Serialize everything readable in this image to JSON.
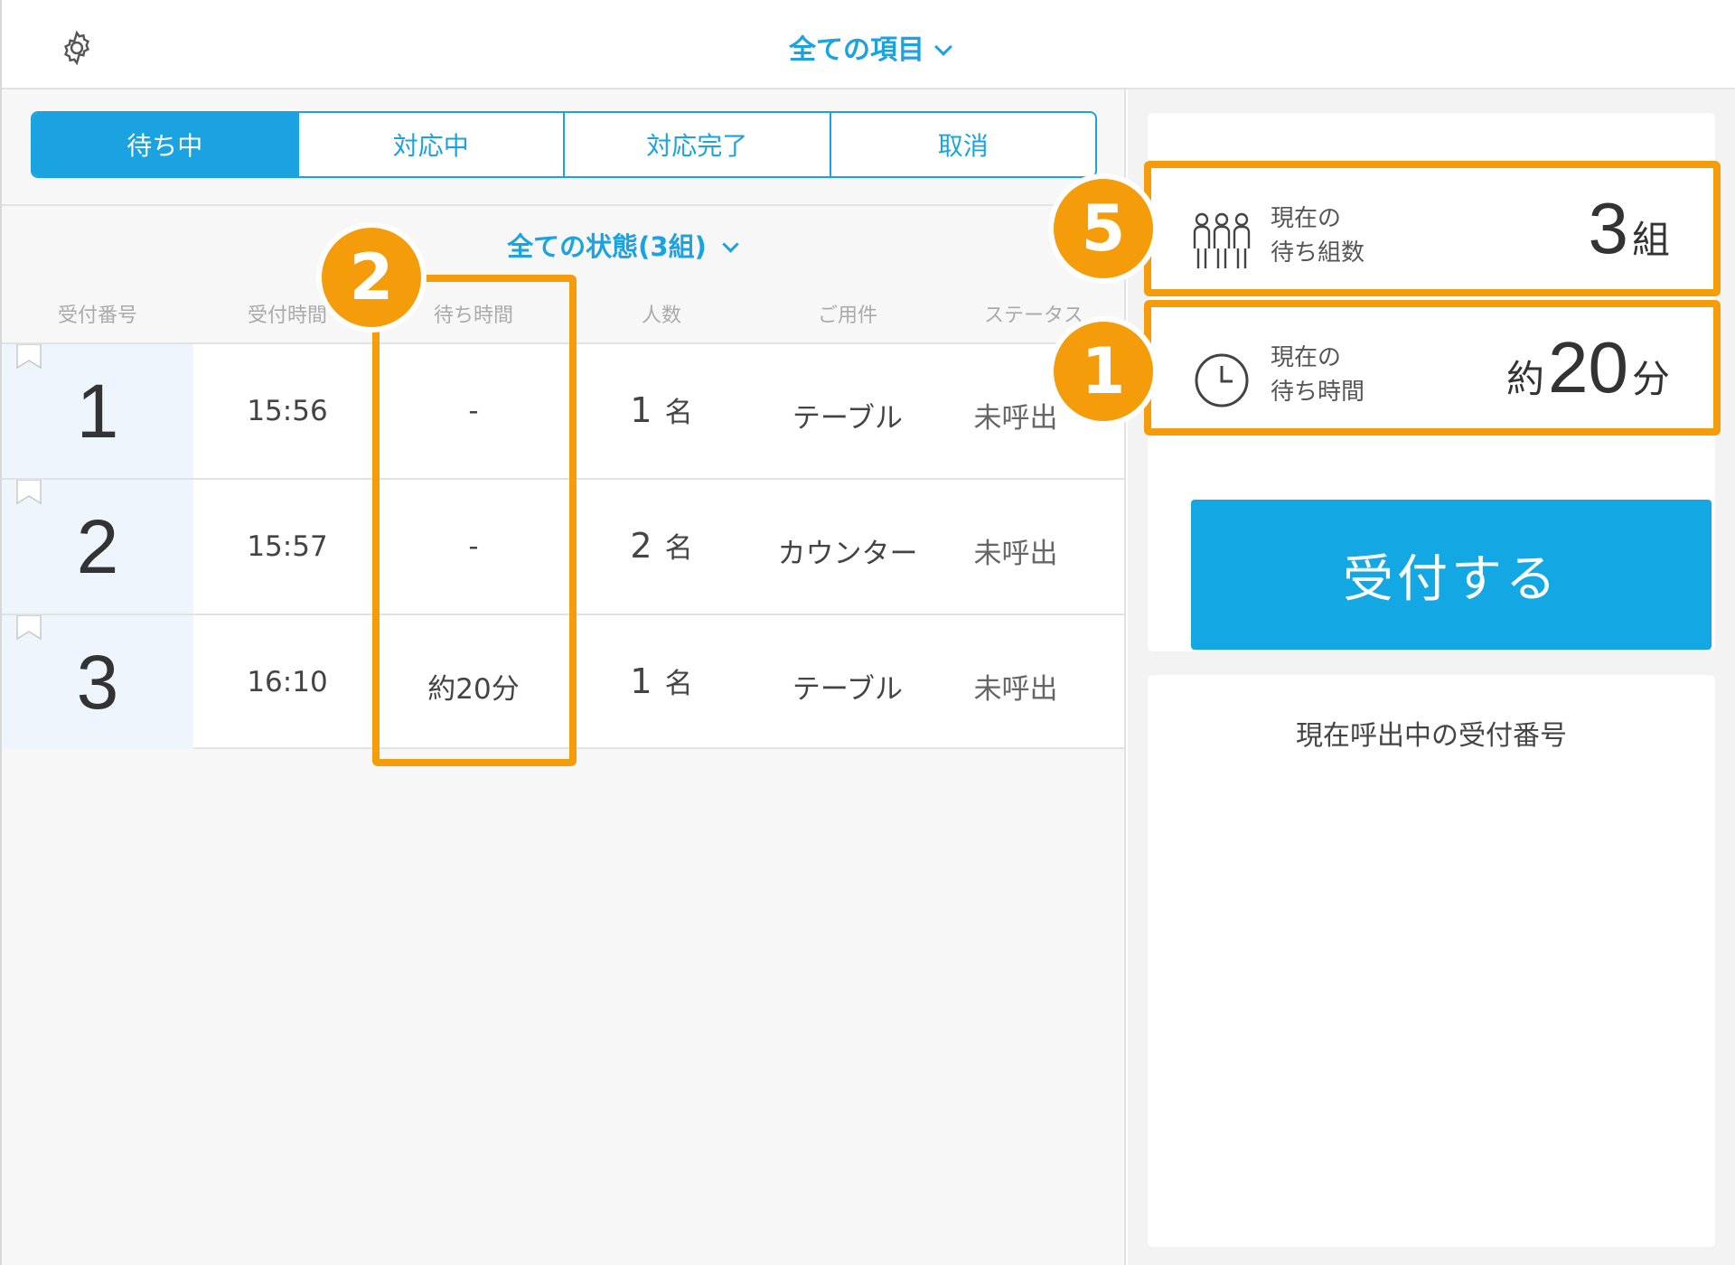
{
  "header": {
    "title": "全ての項目",
    "settings_icon": "gear-icon"
  },
  "tabs": [
    {
      "label": "待ち中",
      "active": true
    },
    {
      "label": "対応中",
      "active": false
    },
    {
      "label": "対応完了",
      "active": false
    },
    {
      "label": "取消",
      "active": false
    }
  ],
  "filter": {
    "label": "全ての状態(3組)"
  },
  "columns": [
    "受付番号",
    "受付時間",
    "待ち時間",
    "人数",
    "ご用件",
    "ステータス"
  ],
  "rows": [
    {
      "number": "1",
      "time": "15:56",
      "wait": "-",
      "people": "1",
      "people_unit": "名",
      "purpose": "テーブル",
      "status": "未呼出"
    },
    {
      "number": "2",
      "time": "15:57",
      "wait": "-",
      "people": "2",
      "people_unit": "名",
      "purpose": "カウンター",
      "status": "未呼出"
    },
    {
      "number": "3",
      "time": "16:10",
      "wait": "約20分",
      "people": "1",
      "people_unit": "名",
      "purpose": "テーブル",
      "status": "未呼出"
    }
  ],
  "stats": {
    "groups": {
      "label_line1": "現在の",
      "label_line2": "待ち組数",
      "value": "3",
      "unit": "組",
      "icon": "people-group-icon"
    },
    "wait": {
      "label_line1": "現在の",
      "label_line2": "待ち時間",
      "prefix": "約",
      "value": "20",
      "unit": "分",
      "icon": "clock-icon"
    }
  },
  "register_button": "受付する",
  "calling_title": "現在呼出中の受付番号",
  "annotations": {
    "badge_1": "1",
    "badge_2": "2",
    "badge_5": "5",
    "color": "#f59c0a"
  },
  "colors": {
    "accent": "#1aa3e0",
    "button": "#13a8e3",
    "highlight": "#f59c0a"
  }
}
